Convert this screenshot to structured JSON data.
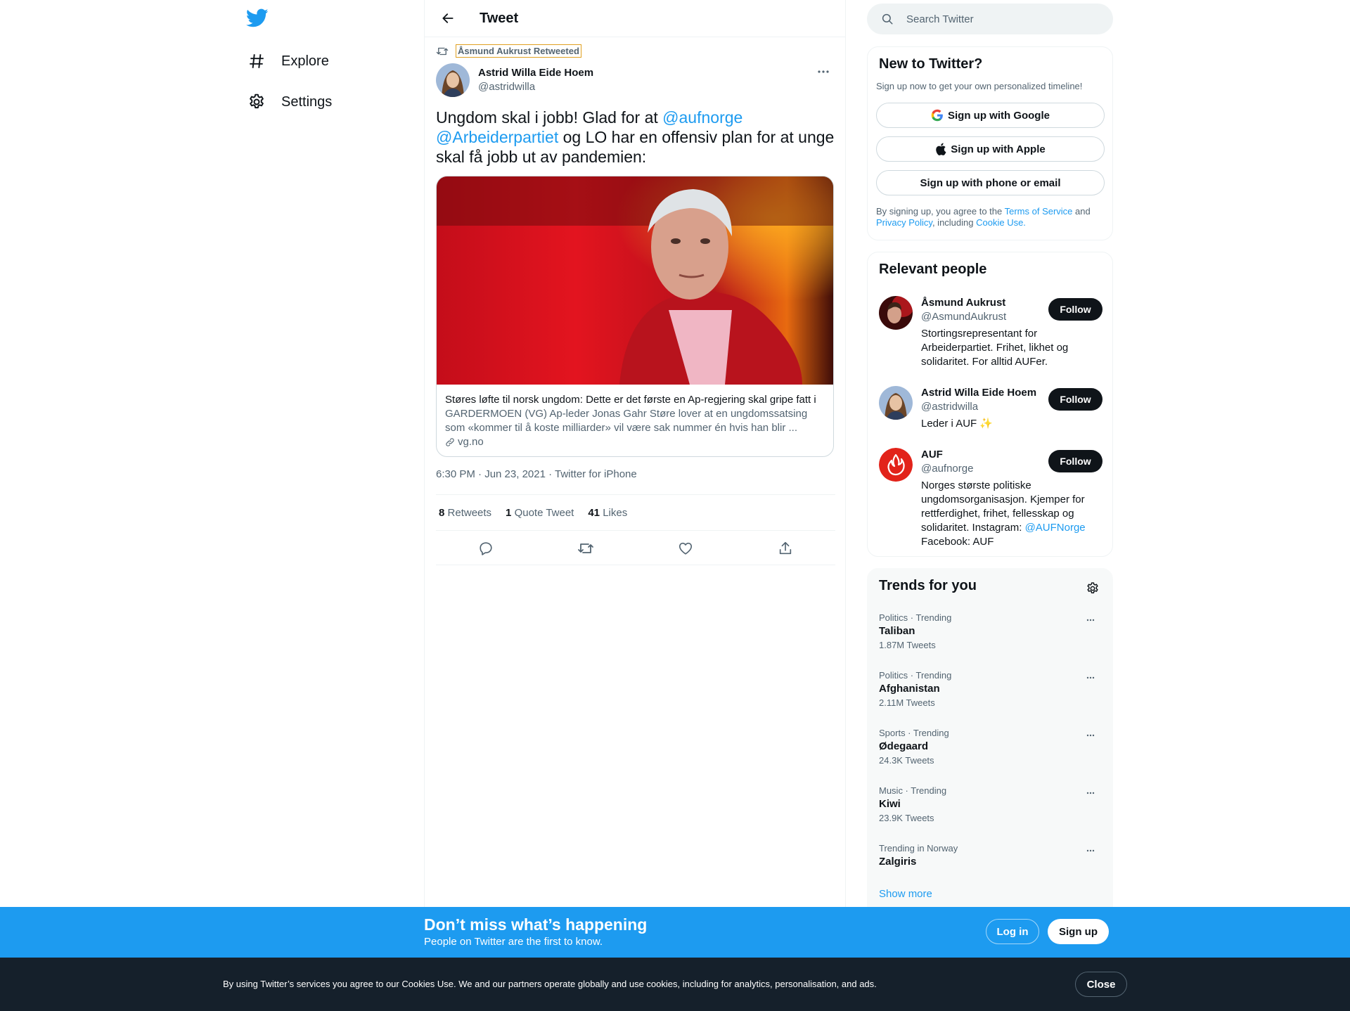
{
  "nav": {
    "items": [
      {
        "label": "Explore",
        "icon": "hashtag-icon"
      },
      {
        "label": "Settings",
        "icon": "gear-icon"
      }
    ]
  },
  "header": {
    "title": "Tweet"
  },
  "tweet": {
    "retweeted_by": "Åsmund Aukrust Retweeted",
    "author_name": "Astrid Willa Eide Hoem",
    "author_handle": "@astridwilla",
    "text_part1": "Ungdom skal i jobb! Glad for at ",
    "mention1": "@aufnorge",
    "mention2": "@Arbeiderpartiet",
    "text_part2": " og LO har en offensiv plan for at unge skal få jobb ut av pandemien:",
    "card": {
      "title": "Støres løfte til norsk ungdom: Dette er det første en Ap-regjering skal gripe fatt i",
      "description": "GARDERMOEN (VG) Ap-leder Jonas Gahr Støre lover at en ungdomssatsing som «kommer til å koste milliarder» vil være sak nummer én hvis han blir ...",
      "domain": "vg.no"
    },
    "time": "6:30 PM · Jun 23, 2021",
    "source": "Twitter for iPhone",
    "stats": {
      "retweets_count": "8",
      "retweets_label": "Retweets",
      "quotes_count": "1",
      "quotes_label": "Quote Tweet",
      "likes_count": "41",
      "likes_label": "Likes"
    }
  },
  "search": {
    "placeholder": "Search Twitter"
  },
  "new_to_twitter": {
    "title": "New to Twitter?",
    "subtitle": "Sign up now to get your own personalized timeline!",
    "google_btn": "Sign up with Google",
    "apple_btn": "Sign up with Apple",
    "phone_btn": "Sign up with phone or email",
    "legal_1": "By signing up, you agree to the ",
    "terms": "Terms of Service",
    "legal_2": " and ",
    "privacy": "Privacy Policy",
    "legal_3": ", including ",
    "cookie": "Cookie Use."
  },
  "relevant": {
    "title": "Relevant people",
    "follow_label": "Follow",
    "people": [
      {
        "name": "Åsmund Aukrust",
        "handle": "@AsmundAukrust",
        "bio": "Stortingsrepresentant for Arbeiderpartiet. Frihet, likhet og solidaritet. For alltid AUFer."
      },
      {
        "name": "Astrid Willa Eide Hoem",
        "handle": "@astridwilla",
        "bio": "Leder i AUF ✨"
      },
      {
        "name": "AUF",
        "handle": "@aufnorge",
        "bio_1": "Norges største politiske ungdomsorganisasjon. Kjemper for rettferdighet, frihet, fellesskap og solidaritet. Instagram: ",
        "bio_link": "@AUFNorge",
        "bio_2": " Facebook: AUF"
      }
    ]
  },
  "trends": {
    "title": "Trends for you",
    "items": [
      {
        "meta": "Politics · Trending",
        "name": "Taliban",
        "count": "1.87M Tweets"
      },
      {
        "meta": "Politics · Trending",
        "name": "Afghanistan",
        "count": "2.11M Tweets"
      },
      {
        "meta": "Sports · Trending",
        "name": "Ødegaard",
        "count": "24.3K Tweets"
      },
      {
        "meta": "Music · Trending",
        "name": "Kiwi",
        "count": "23.9K Tweets"
      },
      {
        "meta": "Trending in Norway",
        "name": "Zalgiris",
        "count": ""
      }
    ],
    "show_more": "Show more"
  },
  "signup_bar": {
    "title": "Don’t miss what’s happening",
    "subtitle": "People on Twitter are the first to know.",
    "login": "Log in",
    "signup": "Sign up"
  },
  "cookie_bar": {
    "text": "By using Twitter’s services you agree to our Cookies Use. We and our partners operate globally and use cookies, including for analytics, personalisation, and ads.",
    "close": "Close"
  },
  "colors": {
    "accent": "#1d9bf0",
    "text": "#0f1419",
    "muted": "#536471",
    "dark": "#15202b"
  }
}
